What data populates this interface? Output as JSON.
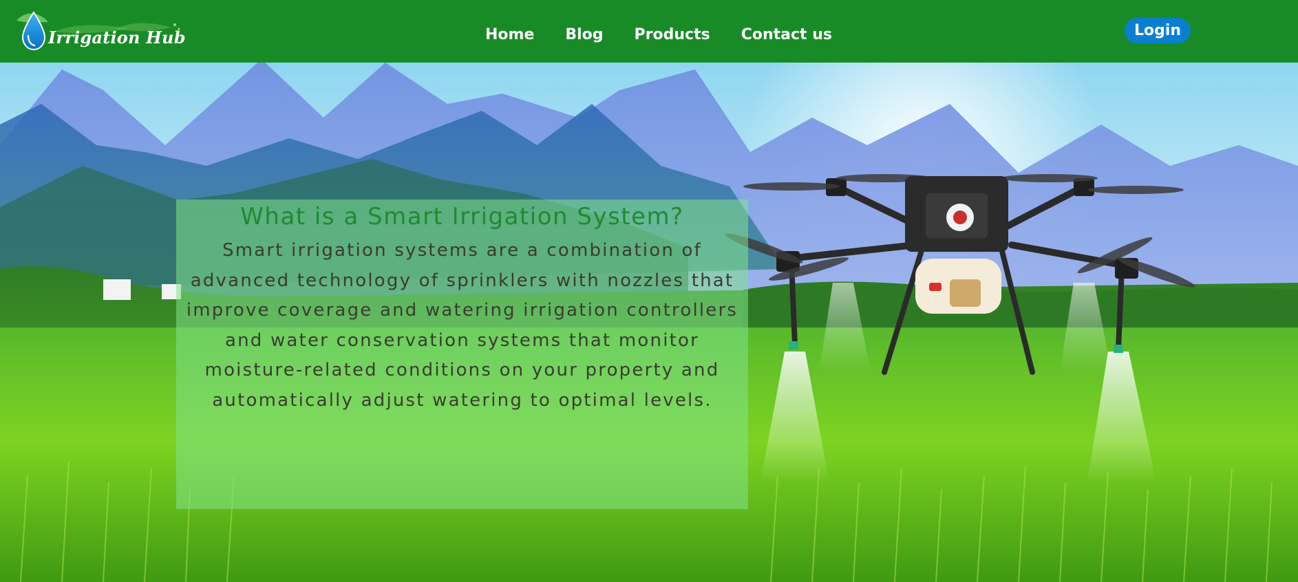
{
  "header": {
    "logo_text": "Irrigation Hub",
    "brand_color": "#188b27",
    "nav": [
      {
        "label": "Home"
      },
      {
        "label": "Blog"
      },
      {
        "label": "Products"
      },
      {
        "label": "Contact us"
      }
    ],
    "login_label": "Login",
    "login_color": "#0a7fd0"
  },
  "hero": {
    "title": "What is a Smart Irrigation System?",
    "body": "Smart irrigation systems are a combination of advanced technology of sprinklers with nozzles that improve coverage and watering irrigation controllers and water conservation systems that monitor moisture-related conditions on your property and automatically adjust watering to optimal levels.",
    "background": "drone-over-rice-field-image",
    "title_color": "#1f8a32"
  }
}
